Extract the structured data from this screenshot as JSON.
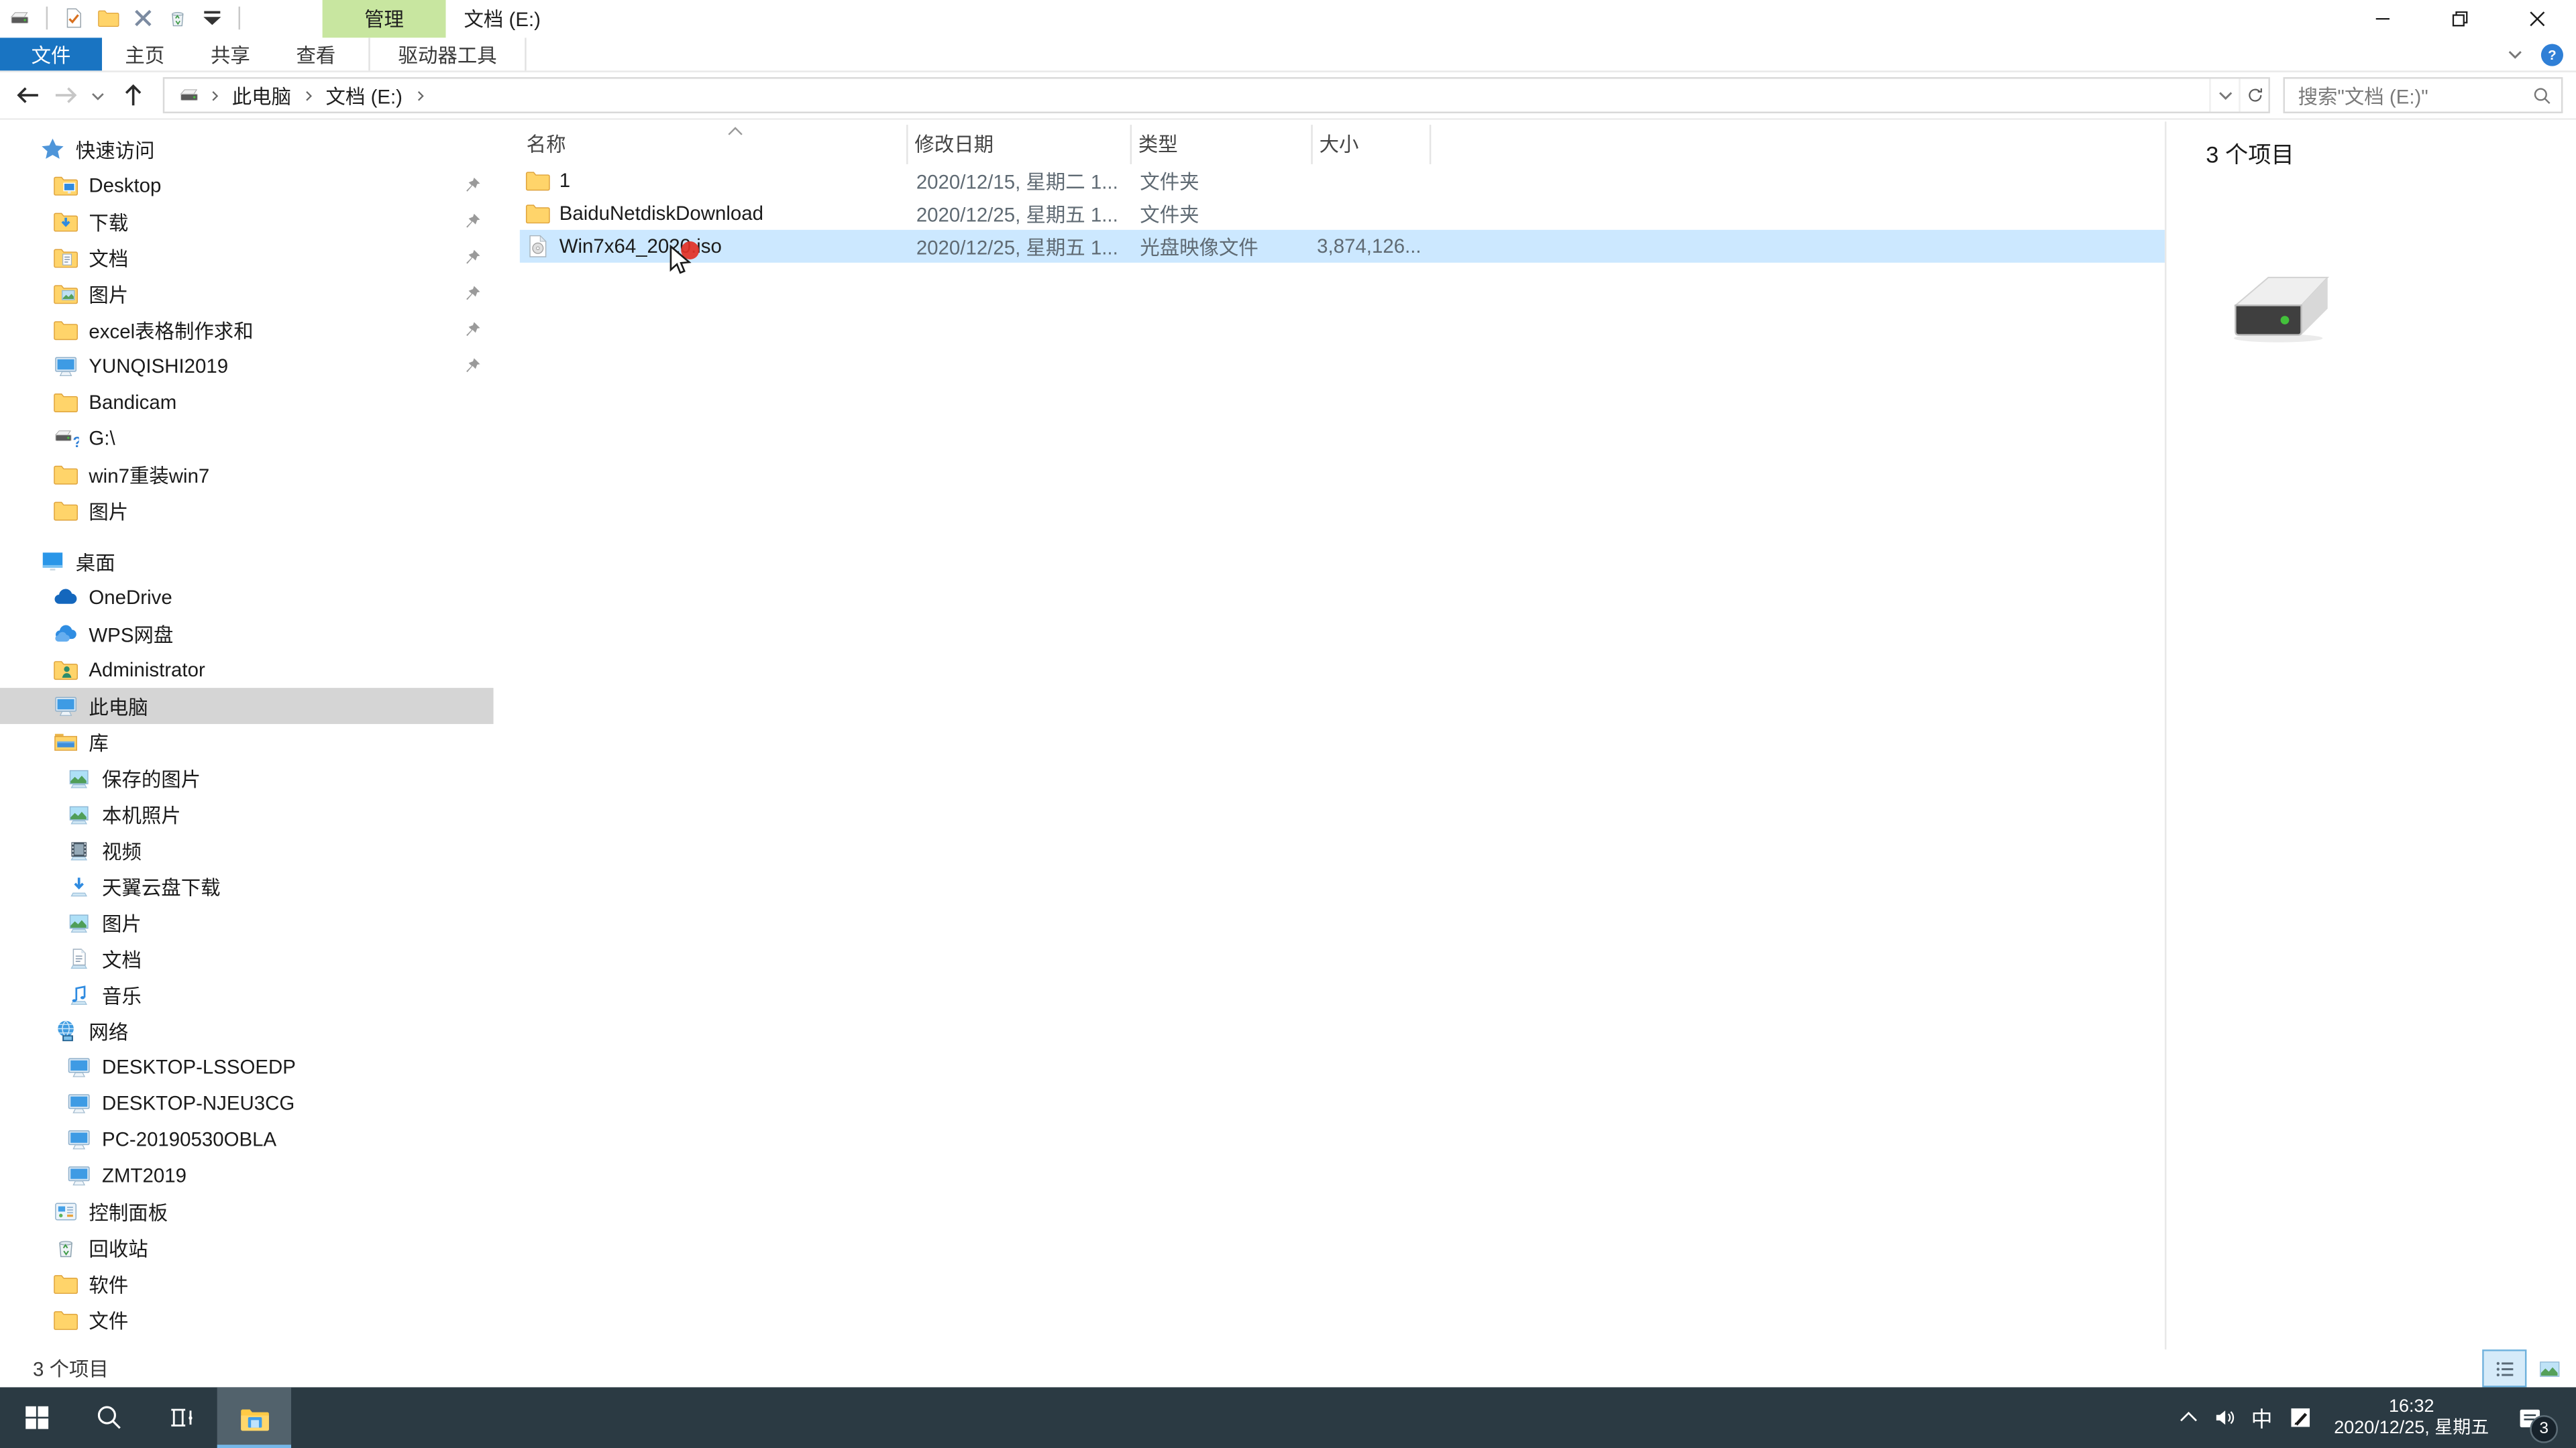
{
  "titlebar": {
    "title": "文档 (E:)",
    "contextual_tab_label": "管理",
    "qat": [
      {
        "icon": "drive-sm",
        "name": "drive-icon"
      },
      {
        "sep": true
      },
      {
        "icon": "doc-check",
        "name": "properties-icon"
      },
      {
        "icon": "folder",
        "name": "new-folder-icon"
      },
      {
        "icon": "delete-x",
        "name": "delete-icon"
      },
      {
        "icon": "recycle-bin",
        "name": "recycle-bin-icon"
      },
      {
        "icon": "qat-dropdown",
        "name": "customize-quick-access-icon"
      },
      {
        "sep": true
      }
    ],
    "window_controls": [
      {
        "icon": "minimize",
        "data_name": "minimize-button"
      },
      {
        "icon": "restore",
        "data_name": "restore-button"
      },
      {
        "icon": "close",
        "data_name": "close-button"
      }
    ]
  },
  "ribbon": {
    "tabs": [
      {
        "label": "文件",
        "file": true,
        "data_name": "tab-file"
      },
      {
        "label": "主页",
        "data_name": "tab-home"
      },
      {
        "label": "共享",
        "data_name": "tab-share"
      },
      {
        "label": "查看",
        "data_name": "tab-view"
      },
      {
        "label": "驱动器工具",
        "contextual": true,
        "data_name": "tab-drive-tools"
      }
    ]
  },
  "address_bar": {
    "crumbs": [
      "此电脑",
      "文档 (E:)"
    ]
  },
  "search": {
    "placeholder": "搜索\"文档 (E:)\""
  },
  "sidebar": {
    "items": [
      {
        "label": "快速访问",
        "icon": "star",
        "level": 0,
        "data_name": "sidebar-item-quick-access"
      },
      {
        "label": "Desktop",
        "icon": "folder-desktop",
        "level": 1,
        "pinned": true,
        "data_name": "sidebar-item-desktop"
      },
      {
        "label": "下载",
        "icon": "folder-download",
        "level": 1,
        "pinned": true,
        "data_name": "sidebar-item-downloads"
      },
      {
        "label": "文档",
        "icon": "folder-doc",
        "level": 1,
        "pinned": true,
        "data_name": "sidebar-item-documents"
      },
      {
        "label": "图片",
        "icon": "folder-pic",
        "level": 1,
        "pinned": true,
        "data_name": "sidebar-item-pictures"
      },
      {
        "label": "excel表格制作求和",
        "icon": "folder",
        "level": 1,
        "pinned": true,
        "data_name": "sidebar-item-excel-folder"
      },
      {
        "label": "YUNQISHI2019",
        "icon": "monitor",
        "level": 1,
        "pinned": true,
        "data_name": "sidebar-item-yunqishi2019"
      },
      {
        "label": "Bandicam",
        "icon": "folder",
        "level": 1,
        "data_name": "sidebar-item-bandicam"
      },
      {
        "label": "G:\\",
        "icon": "drive-q",
        "level": 1,
        "data_name": "sidebar-item-g-drive"
      },
      {
        "label": "win7重装win7",
        "icon": "folder",
        "level": 1,
        "data_name": "sidebar-item-win7-folder"
      },
      {
        "label": "图片",
        "icon": "folder",
        "level": 1,
        "data_name": "sidebar-item-pictures-2"
      },
      {
        "label": "桌面",
        "icon": "desktop-blue",
        "level": 0,
        "gap": true,
        "data_name": "sidebar-item-desktop-root"
      },
      {
        "label": "OneDrive",
        "icon": "cloud-onedrive",
        "level": 1,
        "data_name": "sidebar-item-onedrive"
      },
      {
        "label": "WPS网盘",
        "icon": "cloud-wps",
        "level": 1,
        "data_name": "sidebar-item-wps-cloud"
      },
      {
        "label": "Administrator",
        "icon": "folder-user",
        "level": 1,
        "data_name": "sidebar-item-administrator"
      },
      {
        "label": "此电脑",
        "icon": "monitor",
        "level": 1,
        "selected": true,
        "data_name": "sidebar-item-this-pc"
      },
      {
        "label": "库",
        "icon": "library",
        "level": 1,
        "data_name": "sidebar-item-libraries"
      },
      {
        "label": "保存的图片",
        "icon": "lib-pic",
        "level": 2,
        "data_name": "sidebar-item-saved-pictures"
      },
      {
        "label": "本机照片",
        "icon": "lib-pic",
        "level": 2,
        "data_name": "sidebar-item-camera-roll"
      },
      {
        "label": "视频",
        "icon": "lib-video",
        "level": 2,
        "data_name": "sidebar-item-videos"
      },
      {
        "label": "天翼云盘下载",
        "icon": "lib-download",
        "level": 2,
        "data_name": "sidebar-item-cloud-download"
      },
      {
        "label": "图片",
        "icon": "lib-pic",
        "level": 2,
        "data_name": "sidebar-item-pictures-library"
      },
      {
        "label": "文档",
        "icon": "lib-doc",
        "level": 2,
        "data_name": "sidebar-item-documents-library"
      },
      {
        "label": "音乐",
        "icon": "lib-music",
        "level": 2,
        "data_name": "sidebar-item-music"
      },
      {
        "label": "网络",
        "icon": "network",
        "level": 1,
        "data_name": "sidebar-item-network"
      },
      {
        "label": "DESKTOP-LSSOEDP",
        "icon": "computer",
        "level": 2,
        "data_name": "sidebar-item-desktop-lssoedp"
      },
      {
        "label": "DESKTOP-NJEU3CG",
        "icon": "computer",
        "level": 2,
        "data_name": "sidebar-item-desktop-njeu3cg"
      },
      {
        "label": "PC-20190530OBLA",
        "icon": "computer",
        "level": 2,
        "data_name": "sidebar-item-pc-20190530obla"
      },
      {
        "label": "ZMT2019",
        "icon": "computer",
        "level": 2,
        "data_name": "sidebar-item-zmt2019"
      },
      {
        "label": "控制面板",
        "icon": "control-panel",
        "level": 1,
        "data_name": "sidebar-item-control-panel"
      },
      {
        "label": "回收站",
        "icon": "recycle-bin",
        "level": 1,
        "data_name": "sidebar-item-recycle-bin"
      },
      {
        "label": "软件",
        "icon": "folder",
        "level": 1,
        "data_name": "sidebar-item-software"
      },
      {
        "label": "文件",
        "icon": "folder",
        "level": 1,
        "data_name": "sidebar-item-files"
      }
    ]
  },
  "file_list": {
    "columns": [
      "名称",
      "修改日期",
      "类型",
      "大小"
    ],
    "sort_ascending": true,
    "rows": [
      {
        "name": "1",
        "icon": "folder",
        "date": "2020/12/15, 星期二 1...",
        "type": "文件夹",
        "size": "",
        "data_name": "file-row-1"
      },
      {
        "name": "BaiduNetdiskDownload",
        "icon": "folder",
        "date": "2020/12/25, 星期五 1...",
        "type": "文件夹",
        "size": "",
        "data_name": "file-row-baidunetdiskdownload"
      },
      {
        "name": "Win7x64_2020.iso",
        "icon": "iso-file",
        "date": "2020/12/25, 星期五 1...",
        "type": "光盘映像文件",
        "size": "3,874,126...",
        "selected": true,
        "data_name": "file-row-win7x64-2020-iso"
      }
    ]
  },
  "details_pane": {
    "count": "3 个项目"
  },
  "status_bar": {
    "count": "3 个项目"
  },
  "taskbar": {
    "ime": "中",
    "time": "16:32",
    "date": "2020/12/25, 星期五",
    "notification_badge": "3"
  },
  "colors": {
    "accent_blue": "#1974c2",
    "contextual_tab_green": "#c8e6a0",
    "selection_blue": "#cce8ff",
    "sidebar_selected_gray": "#d5d5d5",
    "taskbar_bg": "#2b3a43",
    "taskbar_underline": "#76b7e8"
  }
}
